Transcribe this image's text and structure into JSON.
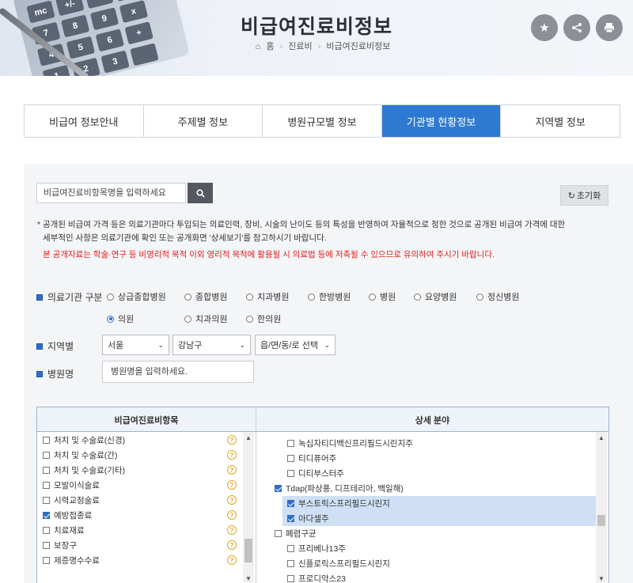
{
  "header": {
    "title": "비급여진료비정보",
    "breadcrumb": [
      "홈",
      "진료비",
      "비급여진료비정보"
    ],
    "calc_keys": [
      "mc",
      "+/-",
      "-",
      "%",
      "7",
      "8",
      "9",
      "x",
      "4",
      "5",
      "6",
      "+",
      "1",
      "2",
      "3",
      ""
    ],
    "buttons": {
      "favorite_icon": "★",
      "share_icon": "⟲",
      "print_icon": "⎙"
    }
  },
  "tabs": [
    {
      "label": "비급여 정보안내",
      "active": false
    },
    {
      "label": "주제별 정보",
      "active": false
    },
    {
      "label": "병원규모별 정보",
      "active": false
    },
    {
      "label": "기관별 현황정보",
      "active": true
    },
    {
      "label": "지역별 정보",
      "active": false
    }
  ],
  "search": {
    "value": "비급여진료비항목명을 입력하세요",
    "reset_label": "초기화"
  },
  "notice": {
    "line1": "* 공개된 비급여 가격 등은 의료기관마다 투입되는 의료인력, 장비, 시술의 난이도 등의 특성을 반영하여 자율적으로 정한 것으로 공개된 비급여 가격에 대한",
    "line2": "세부적인 사항은 의료기관에 확인 또는 공개화면 '상세보기'를 참고하시기 바랍니다.",
    "warning": "본 공개자료는 학술·연구 등 비영리적 목적 이외 영리적 목적에 활용될 시 의료법 등에 저촉될 수 있으므로 유의하여 주시기 바랍니다."
  },
  "filters": {
    "institution_label": "의료기관 구분",
    "institution_types": [
      {
        "label": "상급종합병원",
        "selected": false
      },
      {
        "label": "종합병원",
        "selected": false
      },
      {
        "label": "치과병원",
        "selected": false
      },
      {
        "label": "한방병원",
        "selected": false
      },
      {
        "label": "병원",
        "selected": false
      },
      {
        "label": "요양병원",
        "selected": false
      },
      {
        "label": "정신병원",
        "selected": false
      },
      {
        "label": "의원",
        "selected": true
      },
      {
        "label": "치과의원",
        "selected": false
      },
      {
        "label": "한의원",
        "selected": false
      }
    ],
    "region_label": "지역별",
    "region_selects": [
      "서울",
      "강남구",
      "읍/면/동/로 선택"
    ],
    "hospital_label": "병원명",
    "hospital_placeholder": "병원명을 입력하세요."
  },
  "table": {
    "left_header": "비급여진료비항목",
    "right_header": "상세 분야",
    "left_items": [
      {
        "label": "처치 및 수술료(신경)",
        "checked": false
      },
      {
        "label": "처치 및 수술료(간)",
        "checked": false
      },
      {
        "label": "처치 및 수술료(기타)",
        "checked": false
      },
      {
        "label": "모발이식술료",
        "checked": false
      },
      {
        "label": "시력교정술료",
        "checked": false
      },
      {
        "label": "예방접종료",
        "checked": true
      },
      {
        "label": "치료재료",
        "checked": false
      },
      {
        "label": "보장구",
        "checked": false
      },
      {
        "label": "제증명수수료",
        "checked": false
      }
    ],
    "right_items": [
      {
        "label": "녹십자티디백신프리필드시린지주",
        "checked": false,
        "level": 1,
        "highlight": false
      },
      {
        "label": "티디퓨어주",
        "checked": false,
        "level": 1,
        "highlight": false
      },
      {
        "label": "디티부스터주",
        "checked": false,
        "level": 1,
        "highlight": false
      },
      {
        "label": "Tdap(파상풍, 디프테리아, 백일해)",
        "checked": true,
        "level": 0,
        "highlight": false
      },
      {
        "label": "부스트릭스프리필드시린지",
        "checked": true,
        "level": 1,
        "highlight": true
      },
      {
        "label": "아다셀주",
        "checked": true,
        "level": 1,
        "highlight": true
      },
      {
        "label": "폐렴구균",
        "checked": false,
        "level": 0,
        "highlight": false
      },
      {
        "label": "프리베나13주",
        "checked": false,
        "level": 1,
        "highlight": false
      },
      {
        "label": "신플로릭스프리필드시린지",
        "checked": false,
        "level": 1,
        "highlight": false
      },
      {
        "label": "프로디악스23",
        "checked": false,
        "level": 1,
        "highlight": false
      }
    ]
  },
  "colors": {
    "accent": "#2e7ad3",
    "warning": "#e02020",
    "highlight": "#cfe0f6"
  }
}
